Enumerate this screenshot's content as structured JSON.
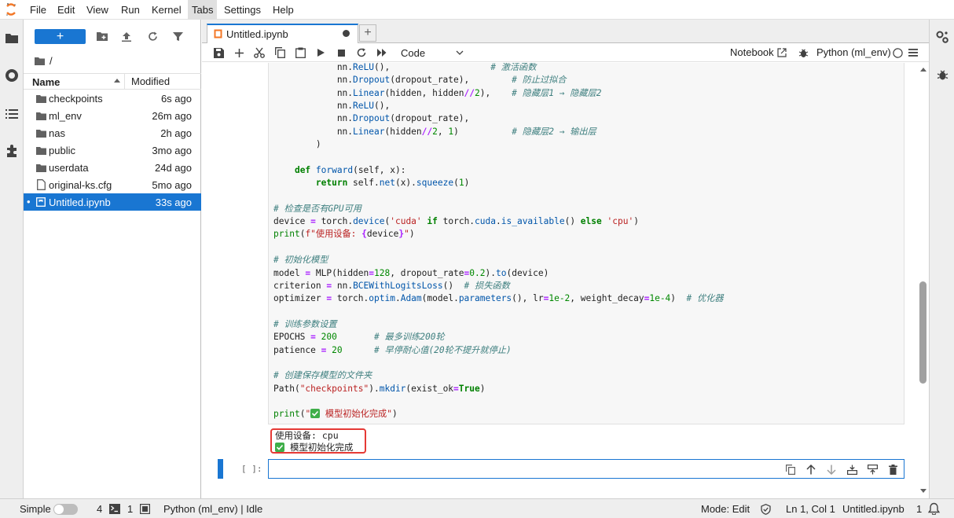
{
  "menubar": {
    "items": [
      "File",
      "Edit",
      "View",
      "Run",
      "Kernel",
      "Tabs",
      "Settings",
      "Help"
    ],
    "active": "Tabs"
  },
  "filebrowser": {
    "new_label": "+",
    "breadcrumb": "/",
    "col_name": "Name",
    "col_modified": "Modified",
    "files": [
      {
        "name": "checkpoints",
        "modified": "6s ago",
        "type": "folder"
      },
      {
        "name": "ml_env",
        "modified": "26m ago",
        "type": "folder"
      },
      {
        "name": "nas",
        "modified": "2h ago",
        "type": "folder"
      },
      {
        "name": "public",
        "modified": "3mo ago",
        "type": "folder"
      },
      {
        "name": "userdata",
        "modified": "24d ago",
        "type": "folder"
      },
      {
        "name": "original-ks.cfg",
        "modified": "5mo ago",
        "type": "file"
      },
      {
        "name": "Untitled.ipynb",
        "modified": "33s ago",
        "type": "notebook",
        "selected": true
      }
    ]
  },
  "tab": {
    "label": "Untitled.ipynb",
    "add": "+"
  },
  "toolbar": {
    "cell_type": "Code",
    "notebook_label": "Notebook",
    "kernel_label": "Python (ml_env)"
  },
  "output": {
    "line1": "使用设备: cpu",
    "line2": "模型初始化完成"
  },
  "new_cell": {
    "prompt": "[ ]:"
  },
  "statusbar": {
    "simple": "Simple",
    "terminals": "4",
    "kernels": "1",
    "kernel_status": "Python (ml_env) | Idle",
    "mode": "Mode: Edit",
    "position": "Ln 1, Col 1",
    "filename": "Untitled.ipynb",
    "notifications": "1"
  },
  "colors": {
    "accent": "#1976d2",
    "highlight_box": "#e53935",
    "check": "#3fae49"
  }
}
